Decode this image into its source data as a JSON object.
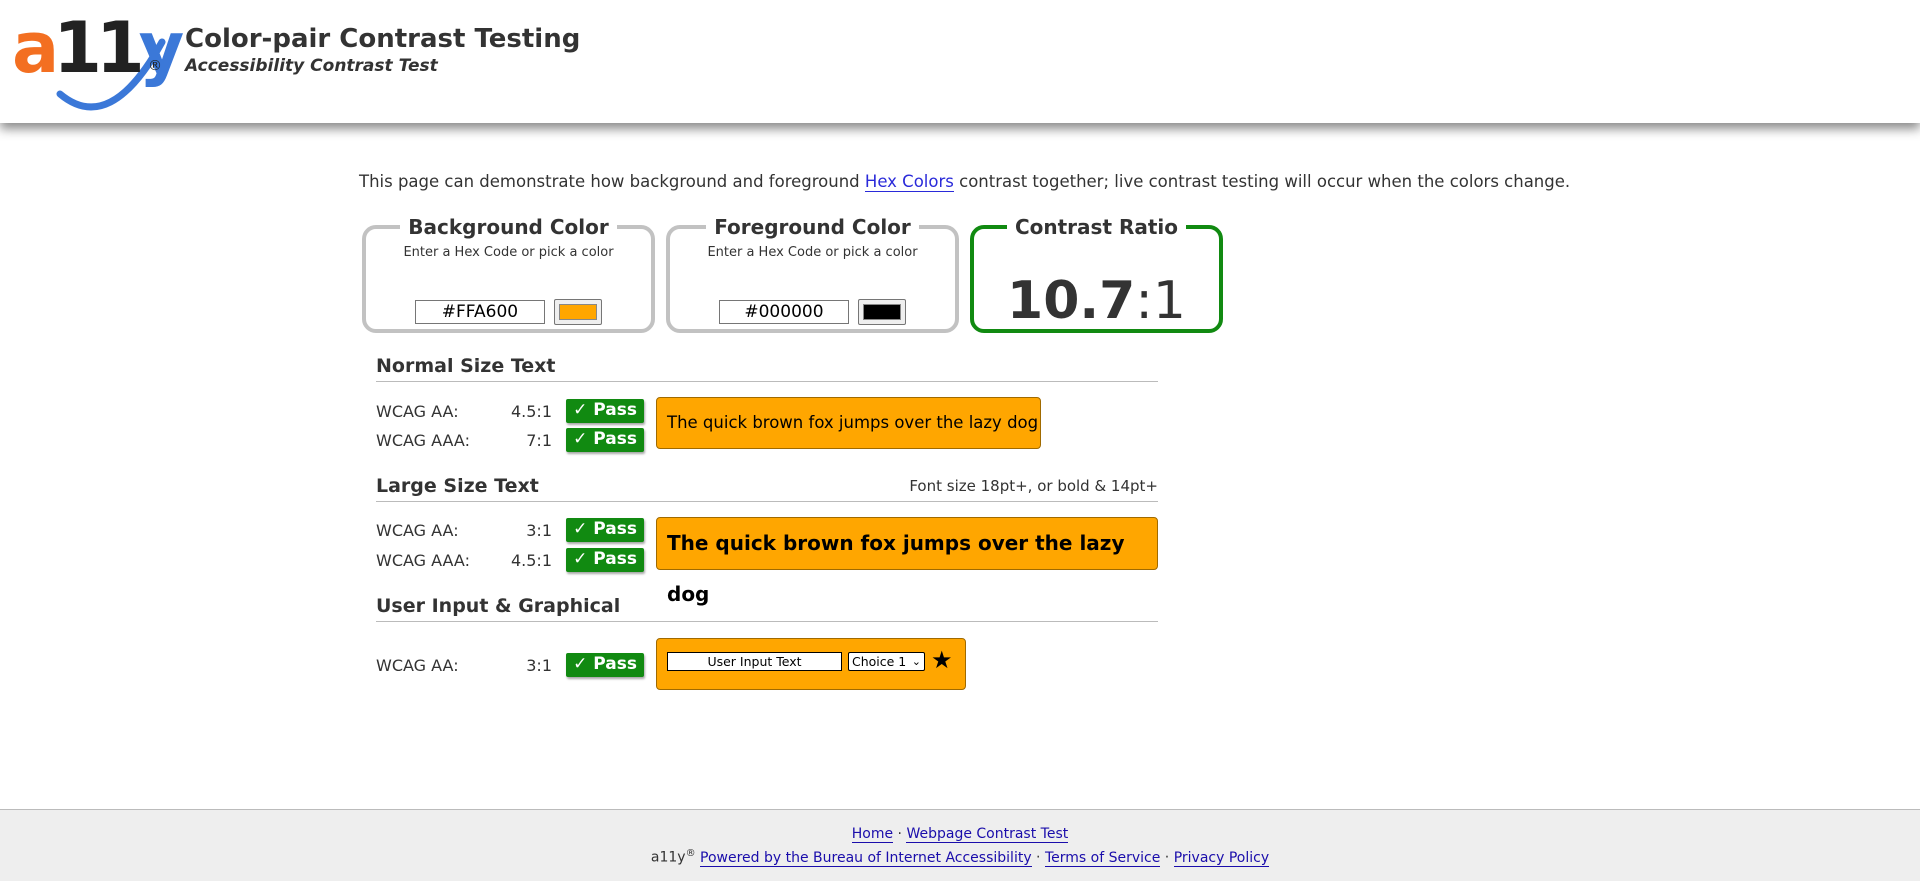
{
  "header": {
    "logo_text": "a11y",
    "logo_reg": "®",
    "title": "Color-pair Contrast Testing",
    "subtitle": "Accessibility Contrast Test"
  },
  "intro": {
    "before": "This page can demonstrate how background and foreground ",
    "link": "Hex Colors",
    "after": " contrast together; live contrast testing will occur when the colors change."
  },
  "background": {
    "legend": "Background Color",
    "hint": "Enter a Hex Code or pick a color",
    "value": "#FFA600",
    "swatch_color": "#FFA600"
  },
  "foreground": {
    "legend": "Foreground Color",
    "hint": "Enter a Hex Code or pick a color",
    "value": "#000000",
    "swatch_color": "#000000"
  },
  "ratio": {
    "legend": "Contrast Ratio",
    "value": "10.7",
    "sep": ":",
    "denom": "1",
    "border_color": "#118a11"
  },
  "normal": {
    "heading": "Normal Size Text",
    "aa_label": "WCAG AA:",
    "aa_value": "4.5:1",
    "aa_result": "✓ Pass",
    "aaa_label": "WCAG AAA:",
    "aaa_value": "7:1",
    "aaa_result": "✓ Pass",
    "sample": "The quick brown fox jumps over the lazy dog"
  },
  "large": {
    "heading": "Large Size Text",
    "note": "Font size 18pt+, or bold & 14pt+",
    "aa_label": "WCAG AA:",
    "aa_value": "3:1",
    "aa_result": "✓ Pass",
    "aaa_label": "WCAG AAA:",
    "aaa_value": "4.5:1",
    "aaa_result": "✓ Pass",
    "sample": "The quick brown fox jumps over the lazy dog"
  },
  "graphical": {
    "heading": "User Input & Graphical",
    "aa_label": "WCAG AA:",
    "aa_value": "3:1",
    "aa_result": "✓ Pass",
    "input_text": "User Input Text",
    "select_value": "Choice 1",
    "star": "★"
  },
  "colors": {
    "pass_green": "#118a11",
    "sample_bg": "#FFA600",
    "sample_fg": "#000000"
  },
  "footer": {
    "home": "Home",
    "dot1": " · ",
    "webpage_test": "Webpage Contrast Test",
    "brand": "a11y",
    "reg": "®",
    "powered": "Powered by the Bureau of Internet Accessibility",
    "dot2": " · ",
    "terms": "Terms of Service",
    "dot3": " · ",
    "privacy": "Privacy Policy"
  }
}
